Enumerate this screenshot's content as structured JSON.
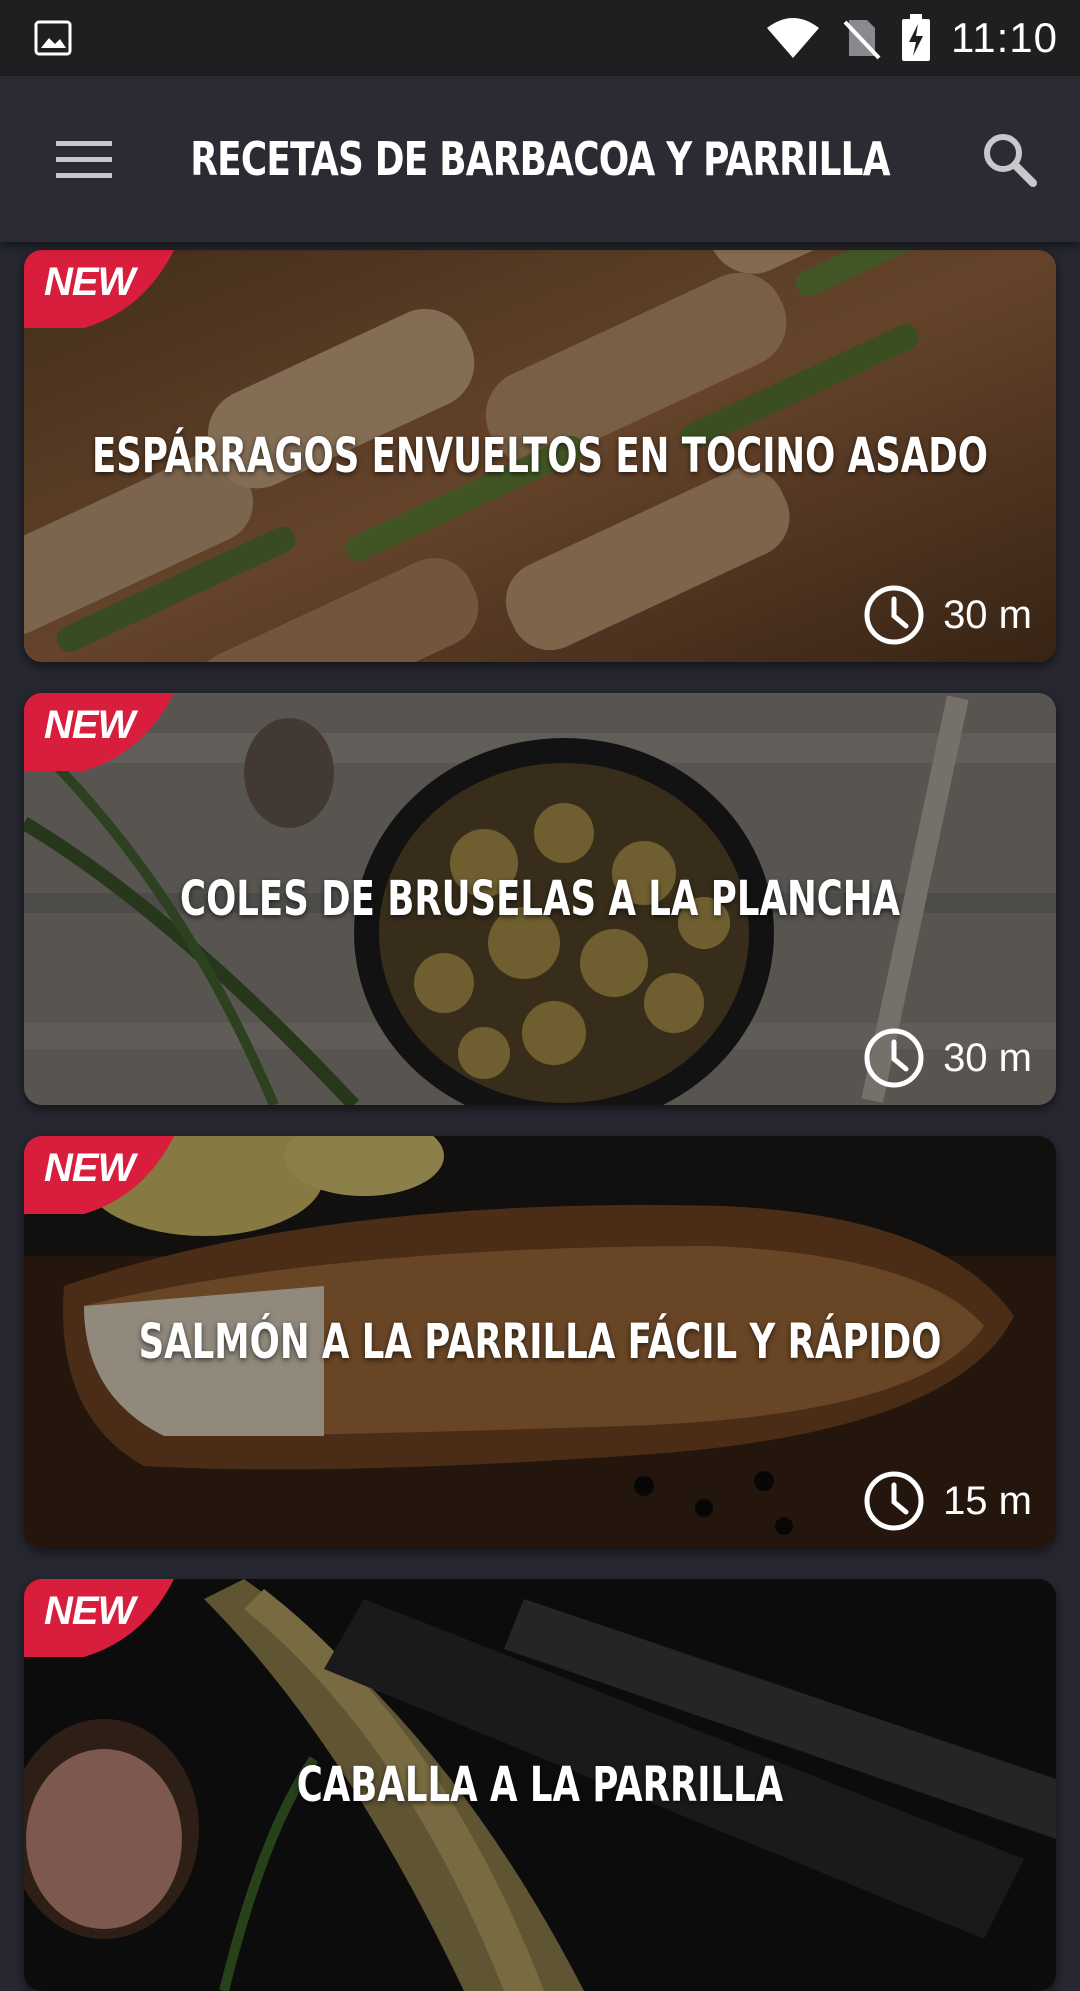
{
  "status_bar": {
    "time": "11:10",
    "icons": [
      "gallery-icon",
      "wifi-icon",
      "no-sim-icon",
      "battery-charging-icon"
    ]
  },
  "app_bar": {
    "title": "RECETAS DE BARBACOA Y PARRILLA",
    "menu_icon": "hamburger-menu-icon",
    "search_icon": "search-icon"
  },
  "recipes": [
    {
      "badge": "NEW",
      "title": "ESPÁRRAGOS ENVUELTOS EN TOCINO ASADO",
      "duration": "30 m"
    },
    {
      "badge": "NEW",
      "title": "COLES DE BRUSELAS A LA PLANCHA",
      "duration": "30 m"
    },
    {
      "badge": "NEW",
      "title": "SALMÓN A LA PARRILLA FÁCIL Y RÁPIDO",
      "duration": "15 m"
    },
    {
      "badge": "NEW",
      "title": "CABALLA A LA PARRILLA",
      "duration": ""
    }
  ],
  "colors": {
    "background": "#262730",
    "app_bar": "#2a2b33",
    "status_bar": "#1f1f22",
    "badge": "#d81e3c",
    "text": "#ffffff"
  }
}
